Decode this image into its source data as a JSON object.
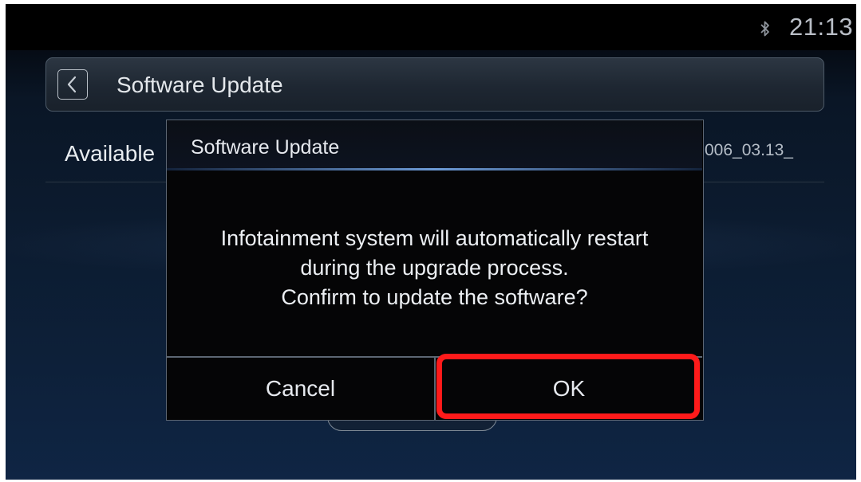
{
  "status_bar": {
    "bluetooth_icon": "bluetooth-icon",
    "clock": "21:13"
  },
  "header": {
    "back_icon": "chevron-left-icon",
    "title": "Software Update"
  },
  "content": {
    "available_label": "Available",
    "version_text": "006_03.13_"
  },
  "dialog": {
    "title": "Software Update",
    "message_lines": [
      "Infotainment system will automatically restart",
      "during the upgrade process.",
      "Confirm to update the software?"
    ],
    "cancel_label": "Cancel",
    "ok_label": "OK"
  },
  "annotation": {
    "highlight_color": "#ff1a1a",
    "highlight_target": "ok-button"
  }
}
